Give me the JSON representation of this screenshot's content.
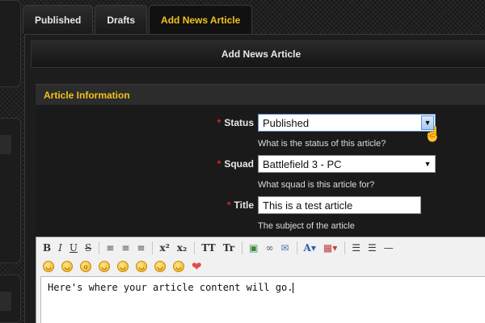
{
  "tabs": [
    {
      "label": "Published"
    },
    {
      "label": "Drafts"
    },
    {
      "label": "Add News Article"
    }
  ],
  "panel": {
    "title": "Add News Article",
    "section_title": "Article Information"
  },
  "form": {
    "required_marker": "*",
    "status": {
      "label": "Status",
      "value": "Published",
      "hint": "What is the status of this article?"
    },
    "squad": {
      "label": "Squad",
      "value": "Battlefield 3 - PC",
      "hint": "What squad is this article for?"
    },
    "title": {
      "label": "Title",
      "value": "This is a test article",
      "hint": "The subject of the article"
    }
  },
  "editor": {
    "toolbar": {
      "bold": "B",
      "italic": "I",
      "underline": "U",
      "strike": "S",
      "superscript": "x²",
      "subscript": "x₂",
      "uppercase": "TT",
      "capitalize": "Tr"
    },
    "content": "Here's where your article content will go."
  },
  "colors": {
    "accent": "#f2c21c",
    "required": "#e02020"
  }
}
